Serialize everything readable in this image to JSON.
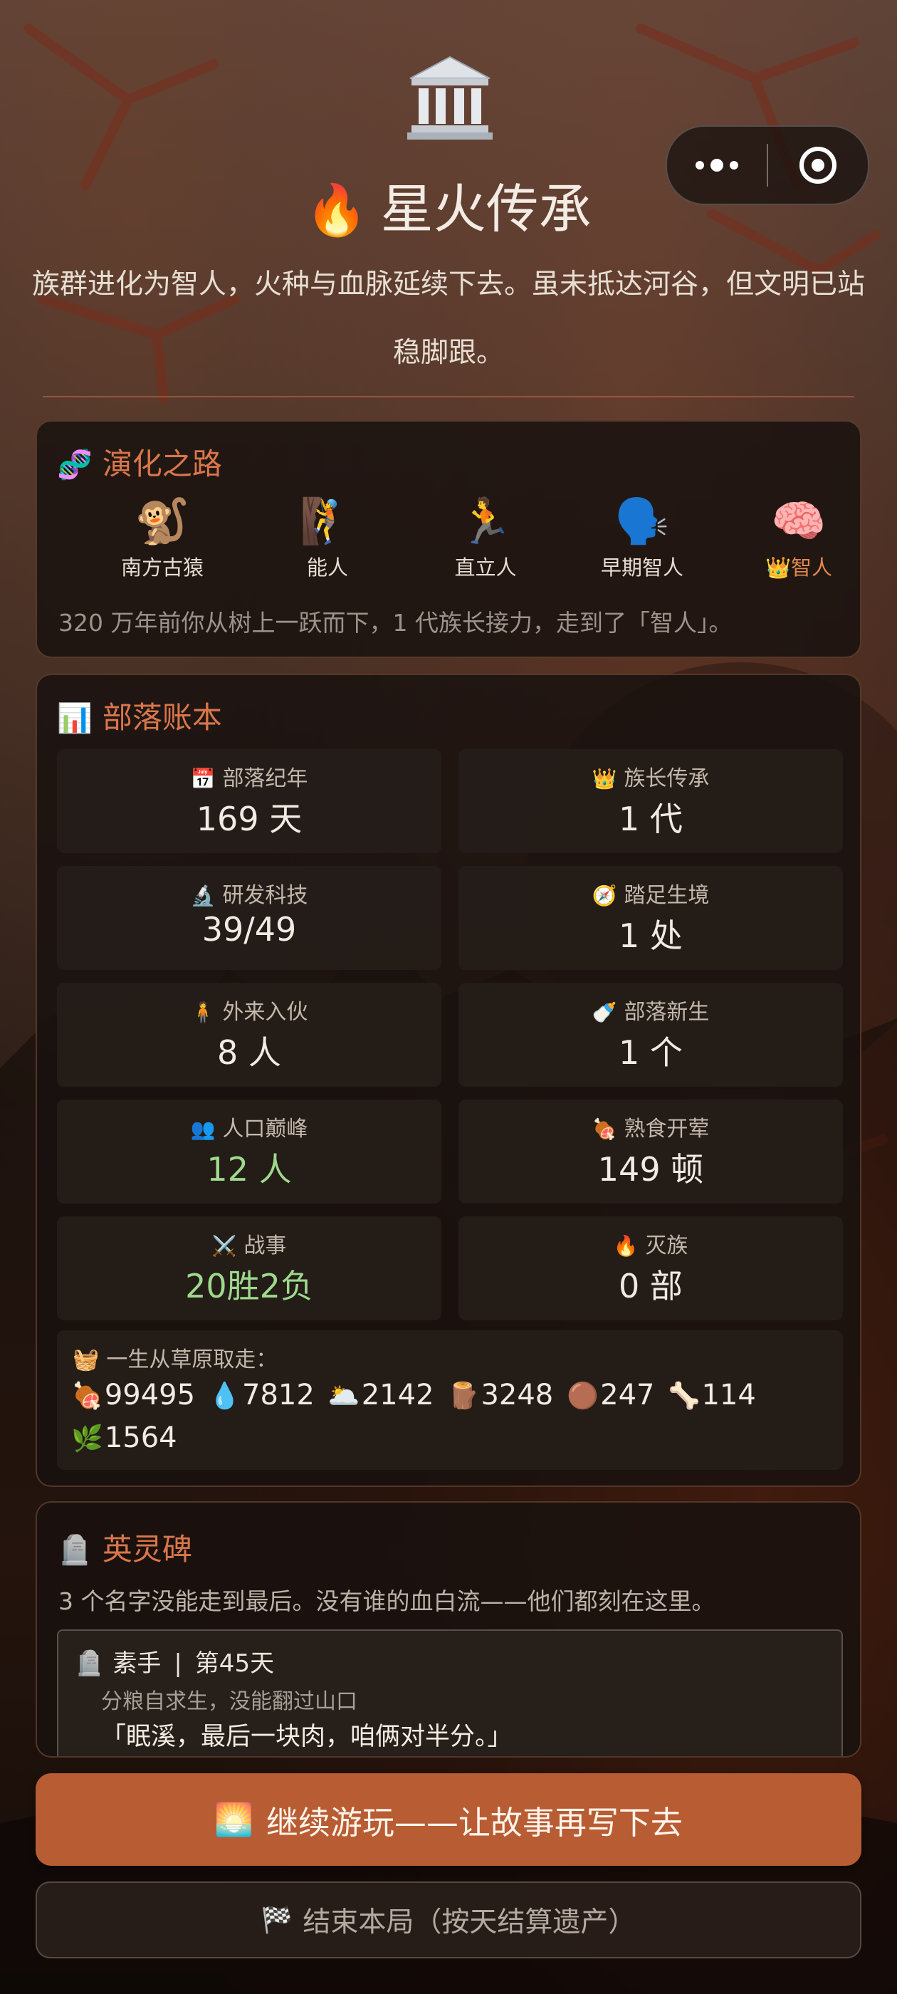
{
  "header": {
    "temple_icon": "classical-building-icon",
    "title_emoji": "🔥",
    "title": "星火传承",
    "subtitle": "族群进化为智人，火种与血脉延续下去。虽未抵达河谷，但文明已站稳脚跟。"
  },
  "capsule": {
    "more_icon": "more-dots-icon",
    "close_icon": "target-close-icon"
  },
  "evolution": {
    "emoji": "🧬",
    "title": "演化之路",
    "stages": [
      {
        "emoji": "🐒",
        "label": "南方古猿",
        "active": false
      },
      {
        "emoji": "🧗",
        "label": "能人",
        "active": false
      },
      {
        "emoji": "🏃",
        "label": "直立人",
        "active": false
      },
      {
        "emoji": "🗣️",
        "label": "早期智人",
        "active": false
      },
      {
        "emoji": "🧠",
        "label": "👑智人",
        "active": true
      }
    ],
    "note": "320 万年前你从树上一跃而下，1 代族长接力，走到了「智人」。"
  },
  "ledger": {
    "emoji": "📊",
    "title": "部落账本",
    "stats": [
      {
        "emoji": "📅",
        "label": "部落纪年",
        "value": "169 天",
        "highlight": false
      },
      {
        "emoji": "👑",
        "label": "族长传承",
        "value": "1 代",
        "highlight": false
      },
      {
        "emoji": "🔬",
        "label": "研发科技",
        "value": "39/49",
        "highlight": false
      },
      {
        "emoji": "🧭",
        "label": "踏足生境",
        "value": "1 处",
        "highlight": false
      },
      {
        "emoji": "🧍",
        "label": "外来入伙",
        "value": "8 人",
        "highlight": false
      },
      {
        "emoji": "🍼",
        "label": "部落新生",
        "value": "1 个",
        "highlight": false
      },
      {
        "emoji": "👥",
        "label": "人口巅峰",
        "value": "12 人",
        "highlight": true
      },
      {
        "emoji": "🍖",
        "label": "熟食开荤",
        "value": "149 顿",
        "highlight": false
      },
      {
        "emoji": "⚔️",
        "label": "战事",
        "value": "20胜2负",
        "highlight": true
      },
      {
        "emoji": "🔥",
        "label": "灭族",
        "value": "0 部",
        "highlight": false
      }
    ],
    "loot": {
      "emoji": "🧺",
      "title": "一生从草原取走：",
      "items": [
        {
          "emoji": "🍖",
          "value": "99495"
        },
        {
          "emoji": "💧",
          "value": "7812"
        },
        {
          "emoji": "🌥️",
          "value": "2142"
        },
        {
          "emoji": "🪵",
          "value": "3248"
        },
        {
          "emoji": "🟤",
          "value": "247"
        },
        {
          "emoji": "🦴",
          "value": "114"
        },
        {
          "emoji": "🌿",
          "value": "1564"
        }
      ]
    }
  },
  "memorial": {
    "emoji": "🪦",
    "title": "英灵碑",
    "note": "3 个名字没能走到最后。没有谁的血白流——他们都刻在这里。",
    "entry": {
      "emoji": "🪦",
      "name": "素手",
      "separator": "|",
      "day": "第45天",
      "cause": "分粮自求生，没能翻过山口",
      "quote": "「眠溪，最后一块肉，咱俩对半分。」"
    }
  },
  "actions": {
    "continue_emoji": "🌅",
    "continue_label": "继续游玩——让故事再写下去",
    "end_emoji": "🏁",
    "end_label": "结束本局（按天结算遗产）"
  }
}
